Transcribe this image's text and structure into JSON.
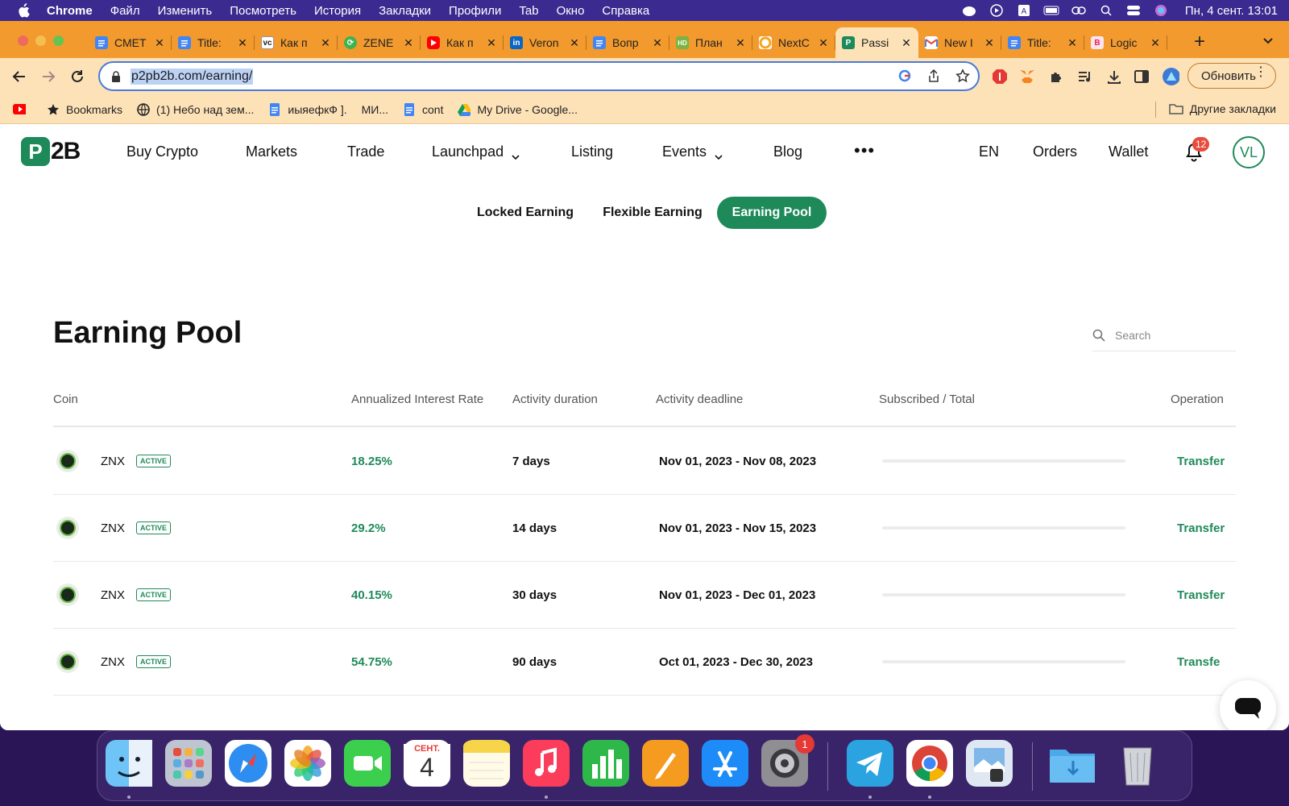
{
  "menubar": {
    "app": "Chrome",
    "items": [
      "Файл",
      "Изменить",
      "Посмотреть",
      "История",
      "Закладки",
      "Профили",
      "Tab",
      "Окно",
      "Справка"
    ],
    "clock": "Пн, 4 сент.  13:01"
  },
  "tabs": [
    {
      "title": "СМЕТ",
      "icon": "google-docs-icon",
      "color": "#4285f4"
    },
    {
      "title": "Title:",
      "icon": "google-docs-icon",
      "color": "#4285f4"
    },
    {
      "title": "Как п",
      "icon": "vc-icon",
      "color": "#ffffff"
    },
    {
      "title": "ZENE",
      "icon": "zene-icon",
      "color": "#3fb34f"
    },
    {
      "title": "Как п",
      "icon": "youtube-icon",
      "color": "#ff0000"
    },
    {
      "title": "Veron",
      "icon": "linkedin-icon",
      "color": "#0a66c2"
    },
    {
      "title": "Вопр",
      "icon": "google-docs-icon",
      "color": "#4285f4"
    },
    {
      "title": "План",
      "icon": "hd-icon",
      "color": "#7cb342"
    },
    {
      "title": "NextC",
      "icon": "nextc-icon",
      "color": "#f5a623"
    },
    {
      "title": "Passi",
      "icon": "p2b-icon",
      "color": "#1e8a5a",
      "active": true
    },
    {
      "title": "New I",
      "icon": "gmail-icon",
      "color": "#ea4335"
    },
    {
      "title": "Title:",
      "icon": "google-docs-icon",
      "color": "#4285f4"
    },
    {
      "title": "Logic",
      "icon": "logic-icon",
      "color": "#e91e63"
    }
  ],
  "toolbar": {
    "url": "p2pb2b.com/earning/",
    "update_label": "Обновить"
  },
  "bookmarks": {
    "items": [
      {
        "label": "",
        "icon": "youtube-icon"
      },
      {
        "label": "Bookmarks",
        "icon": "star-icon"
      },
      {
        "label": "(1) Небо над зем...",
        "icon": "globe-icon"
      },
      {
        "label": "иыяефкФ ].",
        "icon": "google-docs-icon"
      },
      {
        "label": "МИ...",
        "icon": ""
      },
      {
        "label": "cont",
        "icon": "google-docs-icon"
      },
      {
        "label": "My Drive - Google...",
        "icon": "google-drive-icon"
      }
    ],
    "other": "Другие закладки"
  },
  "site": {
    "logo_text": "2B",
    "nav": [
      "Buy Crypto",
      "Markets",
      "Trade",
      "Launchpad",
      "Listing",
      "Events",
      "Blog"
    ],
    "lang": "EN",
    "orders": "Orders",
    "wallet": "Wallet",
    "notifications": "12",
    "avatar": "VL",
    "subtabs": [
      "Locked Earning",
      "Flexible Earning",
      "Earning Pool"
    ],
    "active_subtab": "Earning Pool",
    "heading": "Earning Pool",
    "search_placeholder": "Search",
    "columns": [
      "Coin",
      "Annualized Interest Rate",
      "Activity duration",
      "Activity deadline",
      "Subscribed / Total",
      "Operation"
    ],
    "rows": [
      {
        "coin": "ZNX",
        "status": "ACTIVE",
        "rate": "18.25%",
        "duration": "7 days",
        "deadline": "Nov 01, 2023 - Nov 08, 2023",
        "subscribed_fraction": 0,
        "action": "Transfer"
      },
      {
        "coin": "ZNX",
        "status": "ACTIVE",
        "rate": "29.2%",
        "duration": "14 days",
        "deadline": "Nov 01, 2023 - Nov 15, 2023",
        "subscribed_fraction": 0,
        "action": "Transfer"
      },
      {
        "coin": "ZNX",
        "status": "ACTIVE",
        "rate": "40.15%",
        "duration": "30 days",
        "deadline": "Nov 01, 2023 - Dec 01, 2023",
        "subscribed_fraction": 0,
        "action": "Transfer"
      },
      {
        "coin": "ZNX",
        "status": "ACTIVE",
        "rate": "54.75%",
        "duration": "90 days",
        "deadline": "Oct 01, 2023 - Dec 30, 2023",
        "subscribed_fraction": 0,
        "action": "Transfe"
      }
    ],
    "accent": "#1e8a5a"
  },
  "dock": {
    "apps": [
      "finder",
      "launchpad",
      "safari",
      "photos",
      "facetime",
      "calendar",
      "notes",
      "music",
      "numbers",
      "pages",
      "app-store",
      "system-settings",
      "telegram",
      "chrome",
      "preview",
      "downloads",
      "trash"
    ],
    "calendar_month": "СЕНТ.",
    "calendar_day": "4",
    "settings_badge": "1"
  }
}
